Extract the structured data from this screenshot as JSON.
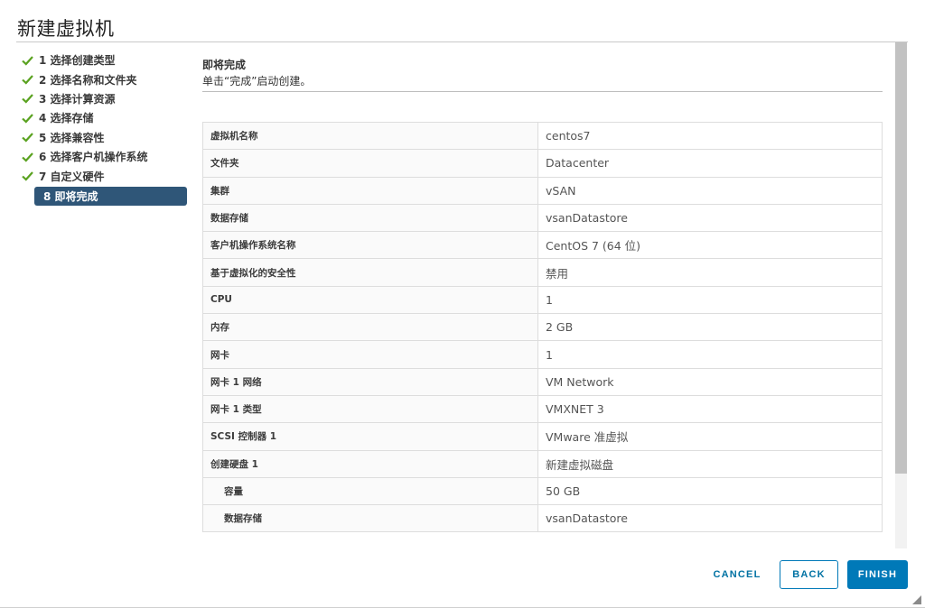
{
  "dialog": {
    "title": "新建虚拟机"
  },
  "steps": [
    {
      "label": "1 选择创建类型",
      "done": true
    },
    {
      "label": "2 选择名称和文件夹",
      "done": true
    },
    {
      "label": "3 选择计算资源",
      "done": true
    },
    {
      "label": "4 选择存储",
      "done": true
    },
    {
      "label": "5 选择兼容性",
      "done": true
    },
    {
      "label": "6 选择客户机操作系统",
      "done": true
    },
    {
      "label": "7 自定义硬件",
      "done": true
    },
    {
      "label": "8 即将完成",
      "done": false,
      "active": true
    }
  ],
  "main": {
    "heading": "即将完成",
    "subtitle": "单击“完成”启动创建。"
  },
  "summary": [
    {
      "key": "虚拟机名称",
      "value": "centos7"
    },
    {
      "key": "文件夹",
      "value": "Datacenter"
    },
    {
      "key": "集群",
      "value": "vSAN"
    },
    {
      "key": "数据存储",
      "value": "vsanDatastore"
    },
    {
      "key": "客户机操作系统名称",
      "value": "CentOS 7 (64 位)"
    },
    {
      "key": "基于虚拟化的安全性",
      "value": "禁用"
    },
    {
      "key": "CPU",
      "value": "1"
    },
    {
      "key": "内存",
      "value": "2 GB"
    },
    {
      "key": "网卡",
      "value": "1"
    },
    {
      "key": "网卡 1 网络",
      "value": "VM Network"
    },
    {
      "key": "网卡 1 类型",
      "value": "VMXNET 3"
    },
    {
      "key": "SCSI 控制器 1",
      "value": "VMware 准虚拟"
    },
    {
      "key": "创建硬盘 1",
      "value": "新建虚拟磁盘"
    },
    {
      "key": "容量",
      "value": "50 GB",
      "indent": true
    },
    {
      "key": "数据存储",
      "value": "vsanDatastore",
      "indent": true
    }
  ],
  "footer": {
    "cancel_label": "CANCEL",
    "back_label": "BACK",
    "finish_label": "FINISH"
  },
  "colors": {
    "accent": "#0079b8",
    "active_step": "#2f5678",
    "check": "#5aa220"
  },
  "icons": {
    "step_done": "check-icon",
    "resize": "resize-grip-icon"
  }
}
